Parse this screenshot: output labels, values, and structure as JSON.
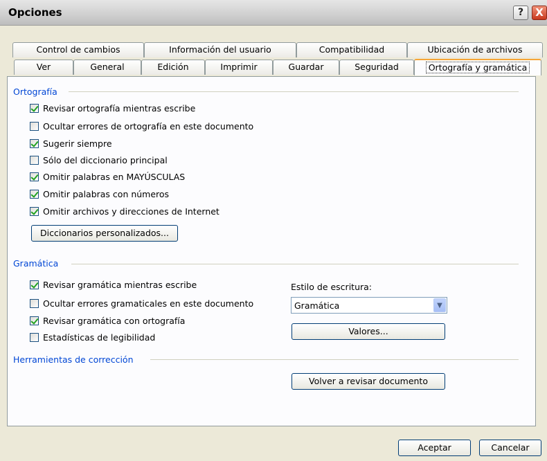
{
  "window": {
    "title": "Opciones"
  },
  "titlebar": {
    "help_label": "?",
    "close_label": "X"
  },
  "tabs_row1": [
    "Control de cambios",
    "Información del usuario",
    "Compatibilidad",
    "Ubicación de archivos"
  ],
  "tabs_row2": [
    "Ver",
    "General",
    "Edición",
    "Imprimir",
    "Guardar",
    "Seguridad",
    "Ortografía y gramática"
  ],
  "active_tab": "Ortografía y gramática",
  "spelling": {
    "group_label": "Ortografía",
    "options": [
      {
        "label": "Revisar ortografía mientras escribe",
        "checked": true
      },
      {
        "label": "Ocultar errores de ortografía en este documento",
        "checked": false
      },
      {
        "label": "Sugerir siempre",
        "checked": true
      },
      {
        "label": "Sólo del diccionario principal",
        "checked": false
      },
      {
        "label": "Omitir palabras en MAYÚSCULAS",
        "checked": true
      },
      {
        "label": "Omitir palabras con números",
        "checked": true
      },
      {
        "label": "Omitir archivos y direcciones de Internet",
        "checked": true
      }
    ],
    "dictionaries_button": "Diccionarios personalizados..."
  },
  "grammar": {
    "group_label": "Gramática",
    "options": [
      {
        "label": "Revisar gramática mientras escribe",
        "checked": true
      },
      {
        "label": "Ocultar errores gramaticales en este documento",
        "checked": false
      },
      {
        "label": "Revisar gramática con ortografía",
        "checked": true
      },
      {
        "label": "Estadísticas de legibilidad",
        "checked": false
      }
    ],
    "style_label": "Estilo de escritura:",
    "style_value": "Gramática",
    "settings_button": "Valores..."
  },
  "proofing": {
    "group_label": "Herramientas de corrección",
    "recheck_button": "Volver a revisar documento"
  },
  "footer": {
    "ok_button": "Aceptar",
    "cancel_button": "Cancelar"
  }
}
